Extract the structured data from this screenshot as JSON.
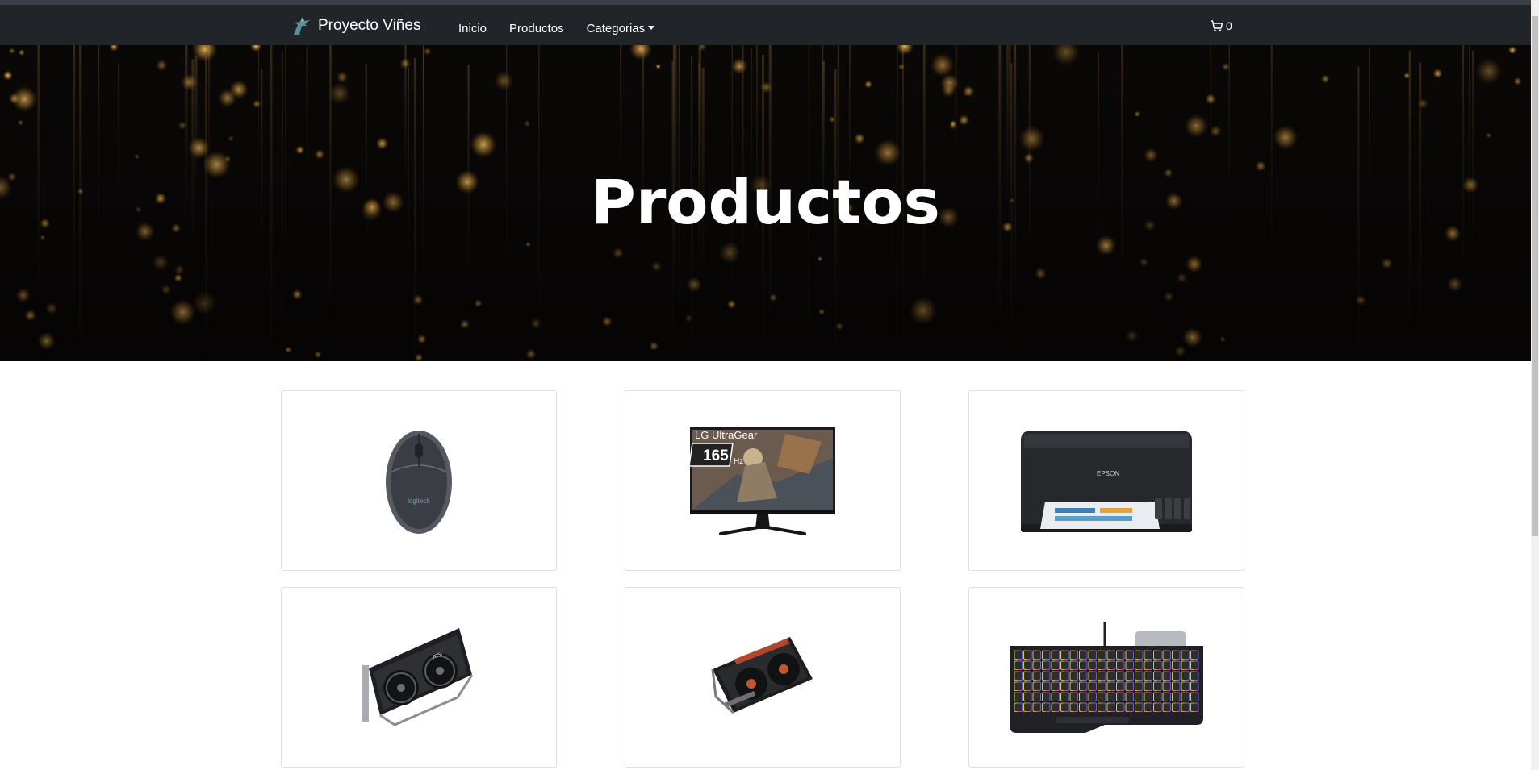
{
  "navbar": {
    "brand": "Proyecto Viñes",
    "links": [
      {
        "label": "Inicio"
      },
      {
        "label": "Productos"
      },
      {
        "label": "Categorias"
      }
    ],
    "cart_count": "0"
  },
  "hero": {
    "title": "Productos"
  },
  "products": [
    {
      "icon": "mouse-image",
      "brand_text": "logitech"
    },
    {
      "icon": "monitor-image",
      "brand_text": "LG UltraGear",
      "badge_text": "165",
      "badge_unit": "Hz"
    },
    {
      "icon": "printer-image",
      "brand_text": "EPSON"
    },
    {
      "icon": "graphics-card-image",
      "brand_text": "msi"
    },
    {
      "icon": "graphics-card-image"
    },
    {
      "icon": "keyboard-image"
    }
  ],
  "colors": {
    "navbar_bg": "#212529",
    "hero_bg": "#0a0807",
    "bokeh": "#d9a441",
    "card_border": "#dfdfdf"
  }
}
